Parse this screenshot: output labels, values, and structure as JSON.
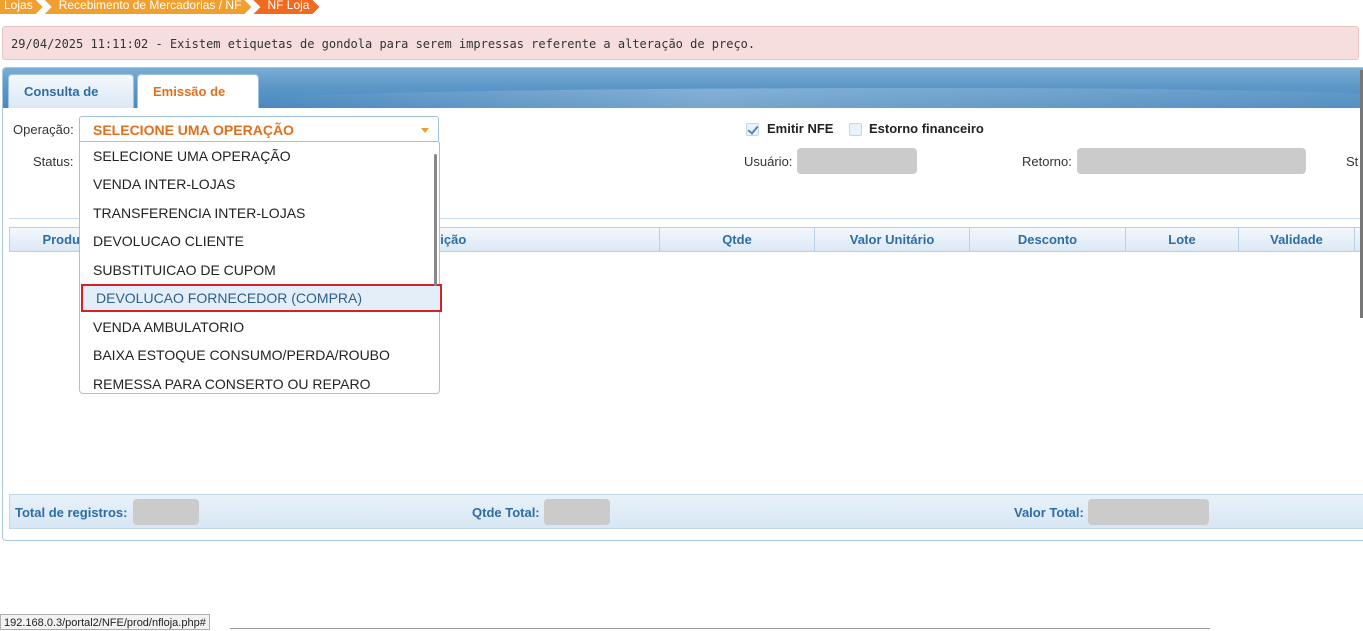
{
  "breadcrumb": [
    "Lojas",
    "Recebimento de Mercadorias / NF",
    "NF Loja"
  ],
  "alert": "29/04/2025 11:11:02 - Existem etiquetas de gondola para serem impressas referente a alteração de preço.",
  "tabs": [
    {
      "label": "Consulta de NF",
      "active": false
    },
    {
      "label": "Emissão de NF",
      "active": true
    }
  ],
  "form": {
    "operacao_label": "Operação:",
    "operacao_value": "SELECIONE UMA OPERAÇÃO",
    "status_label": "Status:",
    "emitir_nfe_label": "Emitir NFE",
    "emitir_nfe_checked": true,
    "estorno_label": "Estorno financeiro",
    "estorno_checked": false,
    "usuario_label": "Usuário:",
    "retorno_label": "Retorno:",
    "st_label": "St"
  },
  "dropdown": {
    "options": [
      "SELECIONE UMA OPERAÇÃO",
      "VENDA INTER-LOJAS",
      "TRANSFERENCIA INTER-LOJAS",
      "DEVOLUCAO CLIENTE",
      "SUBSTITUICAO DE CUPOM",
      "DEVOLUCAO FORNECEDOR (COMPRA)",
      "VENDA AMBULATORIO",
      "BAIXA ESTOQUE CONSUMO/PERDA/ROUBO",
      "REMESSA PARA CONSERTO OU REPARO"
    ],
    "highlighted": "DEVOLUCAO FORNECEDOR (COMPRA)"
  },
  "grid": {
    "columns": [
      "Produ",
      "crição",
      "Qtde",
      "Valor Unitário",
      "Desconto",
      "Lote",
      "Validade"
    ]
  },
  "footer": {
    "total_registros_label": "Total de registros:",
    "qtde_total_label": "Qtde Total:",
    "valor_total_label": "Valor Total:"
  },
  "statusbar": "192.168.0.3/portal2/NFE/prod/nfloja.php#",
  "colors": {
    "accent_orange": "#e07020",
    "header_blue": "#2e6da4",
    "alert_bg": "#f6dede",
    "highlight_border": "#d8202a"
  }
}
